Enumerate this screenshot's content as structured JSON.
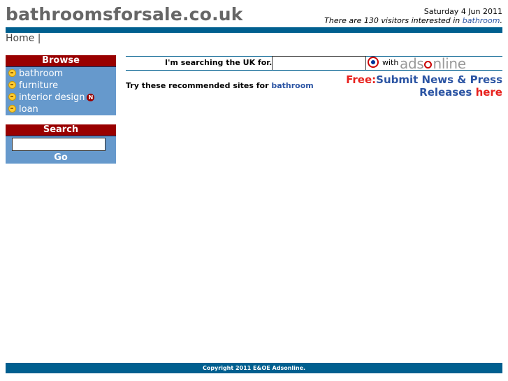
{
  "header": {
    "site_name": "bathroomsforsale.co.uk",
    "date": "Saturday 4 Jun 2011",
    "visitors_prefix": "There are 130 visitors interested in ",
    "visitors_link": "bathroom",
    "visitors_suffix": "."
  },
  "breadcrumb": {
    "home": "Home",
    "separator": "|"
  },
  "browse": {
    "title": "Browse",
    "items": [
      {
        "label": "bathroom"
      },
      {
        "label": "furniture"
      },
      {
        "label": "interior design",
        "badge": "N"
      },
      {
        "label": "loan"
      }
    ]
  },
  "search_panel": {
    "title": "Search",
    "value": "",
    "go_label": "Go"
  },
  "main_search": {
    "label": "I'm searching the UK for...",
    "value": "",
    "with": "with",
    "brand_prefix": "ads",
    "brand_suffix": "nline"
  },
  "recommend": {
    "text": "Try these recommended sites for ",
    "link": "bathroom"
  },
  "promo": {
    "free": "Free:",
    "line1": "Submit News & Press",
    "line2": "Releases ",
    "here": "here"
  },
  "footer": {
    "text": "Copyright 2011 E&OE Adsonline."
  },
  "colors": {
    "bar": "#005f8f",
    "panel": "#6699cc",
    "panel_title": "#990000",
    "link": "#2b54a3",
    "accent_red": "#e8211d"
  }
}
